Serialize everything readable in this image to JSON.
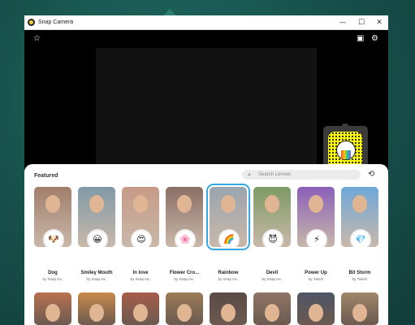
{
  "window": {
    "title": "Snap Camera",
    "minimize": "—",
    "maximize": "☐",
    "close": "✕"
  },
  "toolbar": {
    "favorites_icon": "star-icon",
    "twitch_icon": "twitch-icon",
    "settings_icon": "gear-icon"
  },
  "panel": {
    "section_title": "Featured",
    "search_placeholder": "Search Lenses",
    "history_icon": "history-icon"
  },
  "lenses": [
    {
      "name": "Dog",
      "by": "by Snap Inc.",
      "icon": "🐶",
      "color": "#a07e6a"
    },
    {
      "name": "Smiley Mouth",
      "by": "by Snap Inc.",
      "icon": "😀",
      "color": "#7f9aa8"
    },
    {
      "name": "In love",
      "by": "by Snap Inc.",
      "icon": "😍",
      "color": "#c69b86"
    },
    {
      "name": "Flower Cro...",
      "by": "by Snap Inc.",
      "icon": "🌸",
      "color": "#8a6f66"
    },
    {
      "name": "Rainbow",
      "by": "by Snap Inc.",
      "icon": "🌈",
      "color": "#9aa5ae"
    },
    {
      "name": "Devil",
      "by": "by Snap Inc.",
      "icon": "😈",
      "color": "#7d9a64"
    },
    {
      "name": "Power Up",
      "by": "by Twitch",
      "icon": "⚡",
      "color": "#8a5fb8"
    },
    {
      "name": "Bit Storm",
      "by": "by Twitch",
      "icon": "💎",
      "color": "#6fa8d8"
    }
  ],
  "second_row_colors": [
    "#b8714f",
    "#c98a4a",
    "#a65d4a",
    "#9c7a55",
    "#5a4a45",
    "#8f7566",
    "#4f5566",
    "#a0876a"
  ],
  "selected_lens": "Rainbow"
}
